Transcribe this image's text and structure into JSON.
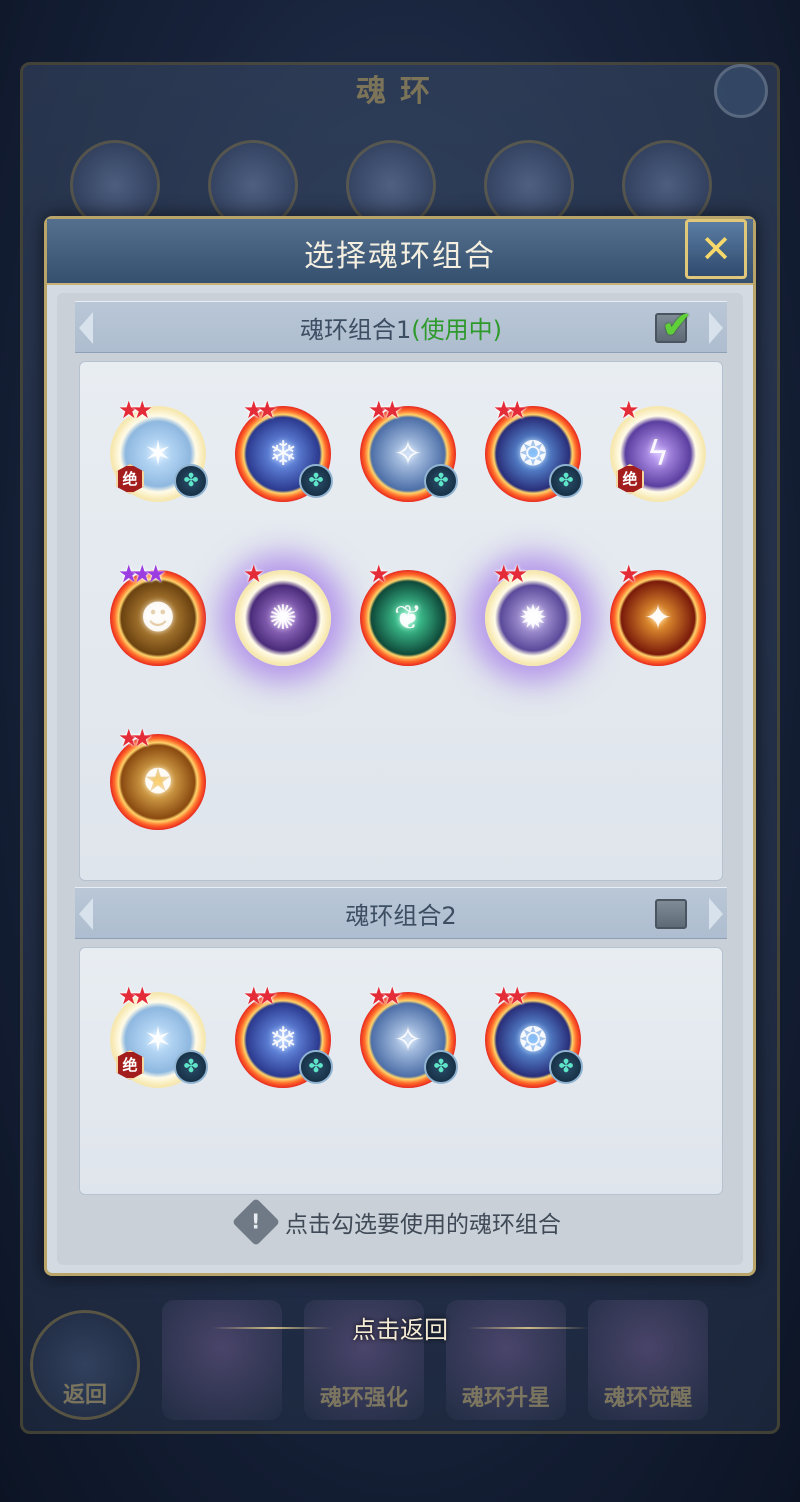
{
  "background": {
    "title": "魂环",
    "back_label": "返回",
    "bottom_tabs": [
      "",
      "魂环强化",
      "魂环升星",
      "魂环觉醒"
    ]
  },
  "back_hint": "点击返回",
  "dialog": {
    "title": "选择魂环组合",
    "close_icon": "✕",
    "footer_hint": "点击勾选要使用的魂环组合"
  },
  "groups": [
    {
      "title": "魂环组合1",
      "status": "(使用中)",
      "checked": true,
      "rings": [
        {
          "style": "white",
          "stars": 2,
          "star_color": "red",
          "jue": true,
          "element": true,
          "icon": "bow-icon",
          "glyph": "✶"
        },
        {
          "style": "red",
          "stars": 2,
          "star_color": "red",
          "jue": false,
          "element": true,
          "icon": "snowflake-icon",
          "glyph": "❄"
        },
        {
          "style": "red",
          "stars": 2,
          "star_color": "red",
          "jue": false,
          "element": true,
          "icon": "ice-shard-icon",
          "glyph": "✧"
        },
        {
          "style": "red",
          "stars": 2,
          "star_color": "red",
          "jue": false,
          "element": true,
          "icon": "blue-flame-icon",
          "glyph": "❂"
        },
        {
          "style": "white",
          "stars": 1,
          "star_color": "red",
          "jue": true,
          "element": false,
          "icon": "lightning-icon",
          "glyph": "ϟ"
        },
        {
          "style": "red",
          "stars": 3,
          "star_color": "purple",
          "jue": false,
          "element": false,
          "icon": "beast-face-icon",
          "glyph": "☻"
        },
        {
          "style": "white",
          "stars": 1,
          "star_color": "red",
          "jue": false,
          "element": false,
          "icon": "purple-claw-icon",
          "glyph": "✺",
          "aura": true
        },
        {
          "style": "red",
          "stars": 1,
          "star_color": "red",
          "jue": false,
          "element": false,
          "icon": "green-wings-icon",
          "glyph": "❦"
        },
        {
          "style": "white",
          "stars": 2,
          "star_color": "red",
          "jue": false,
          "element": false,
          "icon": "dragon-icon",
          "glyph": "✹",
          "aura": true
        },
        {
          "style": "red",
          "stars": 1,
          "star_color": "red",
          "jue": false,
          "element": false,
          "icon": "fire-demon-icon",
          "glyph": "✦"
        },
        {
          "style": "red",
          "stars": 2,
          "star_color": "red",
          "jue": false,
          "element": false,
          "icon": "golden-beast-icon",
          "glyph": "✪"
        }
      ]
    },
    {
      "title": "魂环组合2",
      "status": "",
      "checked": false,
      "rings": [
        {
          "style": "white",
          "stars": 2,
          "star_color": "red",
          "jue": true,
          "element": true,
          "icon": "bow-icon",
          "glyph": "✶"
        },
        {
          "style": "red",
          "stars": 2,
          "star_color": "red",
          "jue": false,
          "element": true,
          "icon": "snowflake-icon",
          "glyph": "❄"
        },
        {
          "style": "red",
          "stars": 2,
          "star_color": "red",
          "jue": false,
          "element": true,
          "icon": "ice-shard-icon",
          "glyph": "✧"
        },
        {
          "style": "red",
          "stars": 2,
          "star_color": "red",
          "jue": false,
          "element": true,
          "icon": "blue-flame-icon",
          "glyph": "❂"
        }
      ]
    }
  ],
  "badges": {
    "jue": "绝",
    "element_glyph": "✤",
    "star_glyph": "★",
    "check_glyph": "✔",
    "warning_glyph": "!"
  },
  "colors": {
    "active_status": "#2f9a2c",
    "ring_red": "#e21d1d",
    "star_red": "#e42b38",
    "star_purple": "#9b3de0",
    "dialog_border": "#b9a56a"
  }
}
